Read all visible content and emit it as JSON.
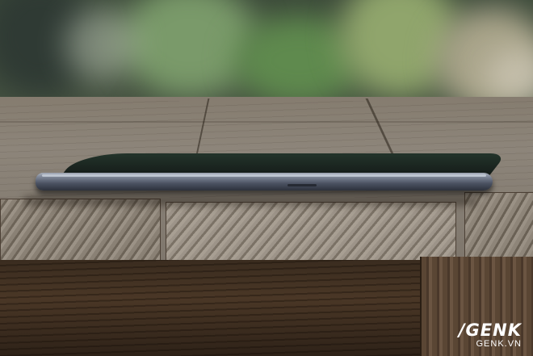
{
  "photo": {
    "subject": "smartphone",
    "watermark": {
      "logo": "/GENK",
      "site": "GENK.VN"
    }
  }
}
